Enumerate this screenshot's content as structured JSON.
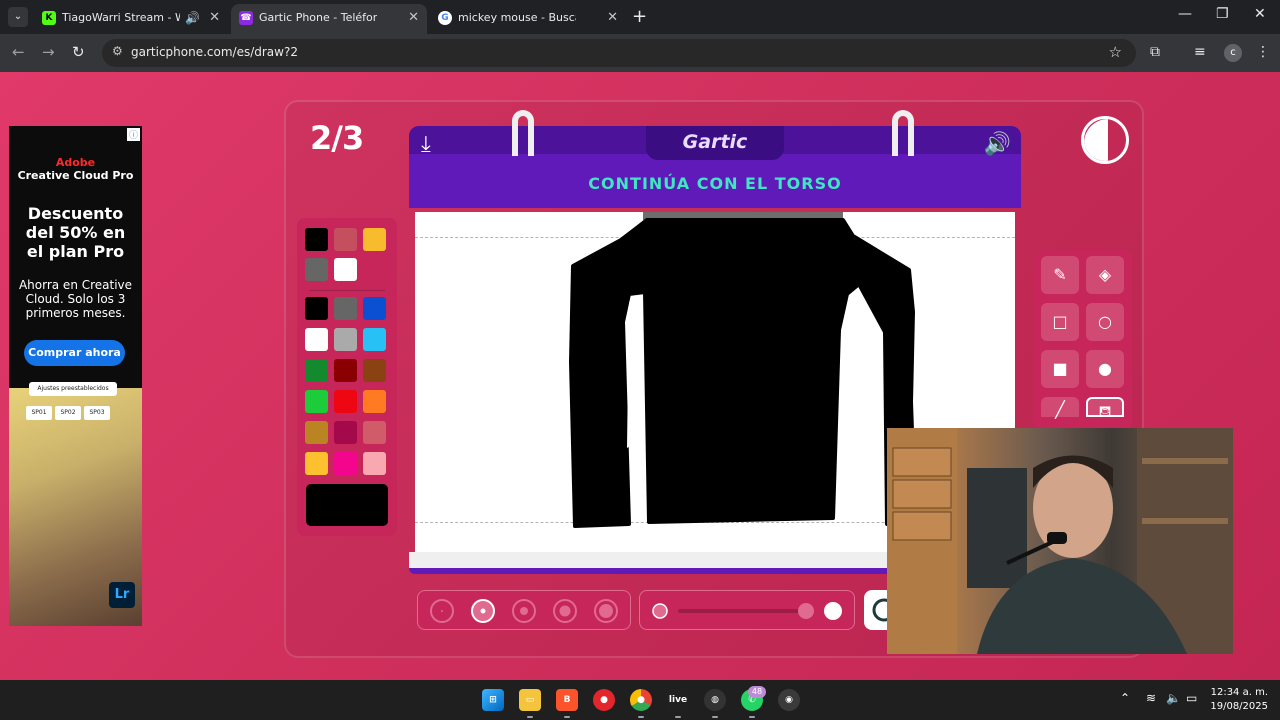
{
  "browser": {
    "tabs": [
      {
        "title": "TiagoWarri Stream - Watch",
        "favicon": "kick-icon",
        "active": false,
        "audio": true
      },
      {
        "title": "Gartic Phone - Teléfono Descon",
        "favicon": "gartic-icon",
        "active": true,
        "audio": false
      },
      {
        "title": "mickey mouse - Buscar con Goo",
        "favicon": "google-icon",
        "active": false,
        "audio": false
      }
    ],
    "url": "garticphone.com/es/draw?2",
    "profile_initial": "c"
  },
  "ad": {
    "info_label": "ⓘ",
    "brand_line1": "Adobe",
    "brand_line2": "Creative Cloud Pro",
    "headline": "Descuento del 50% en el plan Pro",
    "body": "Ahorra en Creative Cloud. Solo los 3 primeros meses.",
    "cta": "Comprar ahora",
    "chip_main": "Ajustes preestablecidos",
    "chips": [
      "SP01",
      "SP02",
      "SP03"
    ],
    "app_badge": "Lr"
  },
  "game": {
    "round": "2/3",
    "logo": "Gartic",
    "instruction": "CONTINÚA CON EL TORSO",
    "timer_fraction_elapsed": 0.5,
    "palette": {
      "top": [
        "#000000",
        "#c4505f",
        "#f8bb2d",
        "#666666",
        "#ffffff"
      ],
      "main": [
        "#000000",
        "#666666",
        "#0b50d3",
        "#ffffff",
        "#aaaaaa",
        "#27c1f5",
        "#138a2e",
        "#8a0000",
        "#8a4212",
        "#1ccc3a",
        "#ee0612",
        "#ff7a22",
        "#ba8423",
        "#a40a4b",
        "#d15c69",
        "#fdc02f",
        "#f3068d",
        "#f8a8ae"
      ],
      "selected": "#000000"
    },
    "tools": [
      "pencil-icon",
      "eraser-icon",
      "rectangle-icon",
      "circle-icon",
      "filled-rectangle-icon",
      "filled-circle-icon",
      "line-icon",
      "bucket-icon"
    ],
    "active_tool": "bucket-icon",
    "brush_sizes": 5,
    "selected_brush_size": 2,
    "opacity": 1.0
  },
  "taskbar": {
    "apps": [
      "windows-icon",
      "file-explorer-icon",
      "brave-icon",
      "app-icon",
      "chrome-icon",
      "live-icon",
      "obs-icon",
      "whatsapp-icon",
      "app2-icon"
    ],
    "whatsapp_badge": "48",
    "time": "12:34 a. m.",
    "date": "19/08/2025"
  }
}
